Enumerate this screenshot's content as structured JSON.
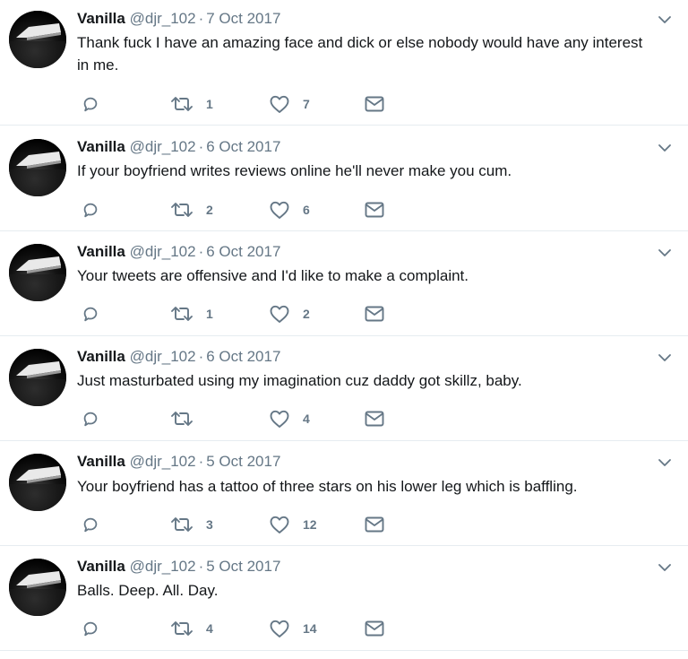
{
  "colors": {
    "text": "#14171a",
    "muted": "#657786",
    "border": "#e6ecf0"
  },
  "icons": [
    "reply-icon",
    "retweet-icon",
    "like-icon",
    "direct-message-icon",
    "chevron-down-icon"
  ],
  "tweets": [
    {
      "name": "Vanilla",
      "handle": "@djr_102",
      "separator": "·",
      "date": "7 Oct 2017",
      "text": "Thank fuck I have an amazing face and dick or else nobody would have any interest in me.",
      "retweets": "1",
      "likes": "7"
    },
    {
      "name": "Vanilla",
      "handle": "@djr_102",
      "separator": "·",
      "date": "6 Oct 2017",
      "text": "If your boyfriend writes reviews online he'll never make you cum.",
      "retweets": "2",
      "likes": "6"
    },
    {
      "name": "Vanilla",
      "handle": "@djr_102",
      "separator": "·",
      "date": "6 Oct 2017",
      "text": "Your tweets are offensive and I'd like to make a complaint.",
      "retweets": "1",
      "likes": "2"
    },
    {
      "name": "Vanilla",
      "handle": "@djr_102",
      "separator": "·",
      "date": "6 Oct 2017",
      "text": "Just masturbated using my imagination cuz daddy got skillz, baby.",
      "retweets": "",
      "likes": "4"
    },
    {
      "name": "Vanilla",
      "handle": "@djr_102",
      "separator": "·",
      "date": "5 Oct 2017",
      "text": "Your boyfriend has a tattoo of three stars on his lower leg which is baffling.",
      "retweets": "3",
      "likes": "12"
    },
    {
      "name": "Vanilla",
      "handle": "@djr_102",
      "separator": "·",
      "date": "5 Oct 2017",
      "text": "Balls. Deep. All. Day.",
      "retweets": "4",
      "likes": "14"
    }
  ]
}
